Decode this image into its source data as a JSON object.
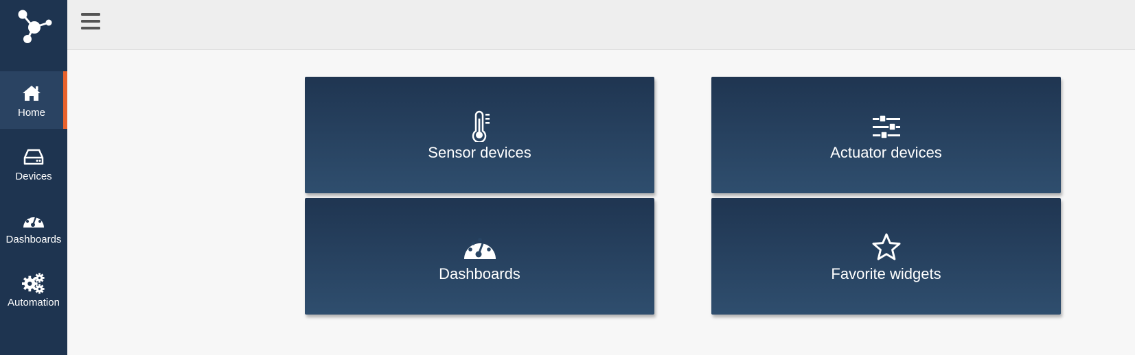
{
  "sidebar": {
    "items": [
      {
        "label": "Home",
        "icon": "home-icon",
        "active": true
      },
      {
        "label": "Devices",
        "icon": "hard-drive-icon",
        "active": false
      },
      {
        "label": "Dashboards",
        "icon": "gauge-icon",
        "active": false
      },
      {
        "label": "Automation",
        "icon": "gears-icon",
        "active": false
      }
    ],
    "active_indicator_color": "#e8622c",
    "background_color": "#1e3450"
  },
  "header": {
    "menu_icon": "hamburger-menu-icon"
  },
  "main": {
    "tiles": [
      {
        "label": "Sensor devices",
        "icon": "thermometer-icon"
      },
      {
        "label": "Actuator devices",
        "icon": "sliders-icon"
      },
      {
        "label": "Dashboards",
        "icon": "gauge-icon"
      },
      {
        "label": "Favorite widgets",
        "icon": "star-icon"
      }
    ]
  }
}
